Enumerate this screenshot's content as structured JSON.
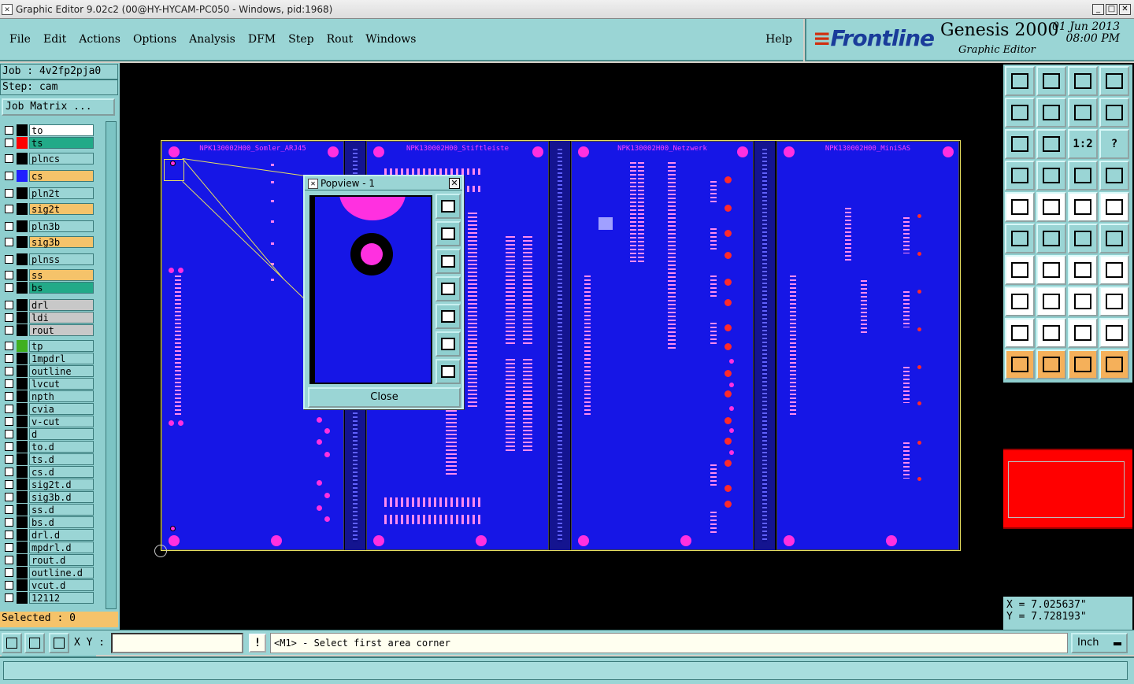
{
  "window": {
    "title": "Graphic Editor 9.02c2 (00@HY-HYCAM-PC050 - Windows, pid:1968)"
  },
  "menu": {
    "items": [
      "File",
      "Edit",
      "Actions",
      "Options",
      "Analysis",
      "DFM",
      "Step",
      "Rout",
      "Windows"
    ],
    "help": "Help"
  },
  "brand": {
    "logo": "Frontline",
    "product": "Genesis 2000",
    "subtitle": "Graphic Editor",
    "date": "01 Jun 2013",
    "time": "08:00 PM"
  },
  "job": {
    "job_label": "Job : 4v2fp2pja0",
    "step_label": "Step: cam",
    "matrix_button": "Job Matrix ..."
  },
  "layers": [
    {
      "name": "to",
      "color": "#ffffff",
      "swatch": "#000000"
    },
    {
      "name": "ts",
      "color": "#22aa88",
      "swatch": "#ff0000"
    },
    {
      "name": "plncs",
      "color": "#9ad5d5",
      "swatch": "#000000"
    },
    {
      "name": "cs",
      "color": "#f5c36a",
      "swatch": "#2020ff"
    },
    {
      "name": "pln2t",
      "color": "#9ad5d5",
      "swatch": "#000000"
    },
    {
      "name": "sig2t",
      "color": "#f5c36a",
      "swatch": "#000000"
    },
    {
      "name": "pln3b",
      "color": "#9ad5d5",
      "swatch": "#000000"
    },
    {
      "name": "sig3b",
      "color": "#f5c36a",
      "swatch": "#000000"
    },
    {
      "name": "plnss",
      "color": "#9ad5d5",
      "swatch": "#000000"
    },
    {
      "name": "ss",
      "color": "#f5c36a",
      "swatch": "#000000"
    },
    {
      "name": "bs",
      "color": "#22aa88",
      "swatch": "#000000"
    },
    {
      "name": "drl",
      "color": "#c8c8c8",
      "swatch": "#000000"
    },
    {
      "name": "ldi",
      "color": "#c8c8c8",
      "swatch": "#000000"
    },
    {
      "name": "rout",
      "color": "#c8c8c8",
      "swatch": "#000000"
    },
    {
      "name": "tp",
      "color": "#9ad5d5",
      "swatch": "#40b020"
    },
    {
      "name": "1mpdrl",
      "color": "#9ad5d5",
      "swatch": "#000000"
    },
    {
      "name": "outline",
      "color": "#9ad5d5",
      "swatch": "#000000"
    },
    {
      "name": "lvcut",
      "color": "#9ad5d5",
      "swatch": "#000000"
    },
    {
      "name": "npth",
      "color": "#9ad5d5",
      "swatch": "#000000"
    },
    {
      "name": "cvia",
      "color": "#9ad5d5",
      "swatch": "#000000"
    },
    {
      "name": "v-cut",
      "color": "#9ad5d5",
      "swatch": "#000000"
    },
    {
      "name": "d",
      "color": "#9ad5d5",
      "swatch": "#000000"
    },
    {
      "name": "to.d",
      "color": "#9ad5d5",
      "swatch": "#000000"
    },
    {
      "name": "ts.d",
      "color": "#9ad5d5",
      "swatch": "#000000"
    },
    {
      "name": "cs.d",
      "color": "#9ad5d5",
      "swatch": "#000000"
    },
    {
      "name": "sig2t.d",
      "color": "#9ad5d5",
      "swatch": "#000000"
    },
    {
      "name": "sig3b.d",
      "color": "#9ad5d5",
      "swatch": "#000000"
    },
    {
      "name": "ss.d",
      "color": "#9ad5d5",
      "swatch": "#000000"
    },
    {
      "name": "bs.d",
      "color": "#9ad5d5",
      "swatch": "#000000"
    },
    {
      "name": "drl.d",
      "color": "#9ad5d5",
      "swatch": "#000000"
    },
    {
      "name": "mpdrl.d",
      "color": "#9ad5d5",
      "swatch": "#000000"
    },
    {
      "name": "rout.d",
      "color": "#9ad5d5",
      "swatch": "#000000"
    },
    {
      "name": "outline.d",
      "color": "#9ad5d5",
      "swatch": "#000000"
    },
    {
      "name": "vcut.d",
      "color": "#9ad5d5",
      "swatch": "#000000"
    },
    {
      "name": "12112",
      "color": "#9ad5d5",
      "swatch": "#000000"
    }
  ],
  "selected": "Selected : 0",
  "boards": [
    {
      "title": "NPK130002H00_Somler_ARJ45"
    },
    {
      "title": "NPK130002H00_Stiftleiste"
    },
    {
      "title": "NPK130002H00_Netzwerk"
    },
    {
      "title": "NPK130002H00_MiniSAS"
    }
  ],
  "popview": {
    "title": "Popview - 1",
    "close_label": "Close"
  },
  "tools": {
    "ratio_label": "1:2",
    "help_label": "?"
  },
  "coords": {
    "x": "X =  7.025637\"",
    "y": "Y =  7.728193\""
  },
  "bottom": {
    "xy_label": "X Y :",
    "prompt": "<M1> - Select first area corner",
    "units": "Inch",
    "excl": "!"
  }
}
